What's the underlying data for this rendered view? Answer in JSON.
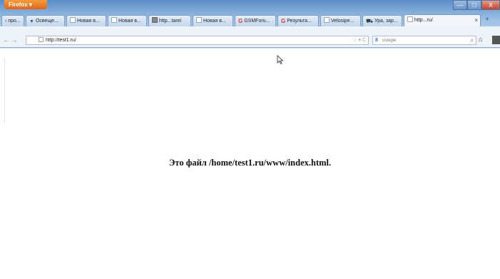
{
  "browser": {
    "app_button": "Firefox",
    "window_controls": [
      "—",
      "□",
      "X"
    ]
  },
  "tabs": [
    {
      "label": "‹ про...",
      "icon": "none"
    },
    {
      "label": "Освеще...",
      "icon": "chevron-down-icon"
    },
    {
      "label": "Новая в...",
      "icon": "blank-page-icon"
    },
    {
      "label": "Новая в...",
      "icon": "blank-page-icon"
    },
    {
      "label": "http...tarei",
      "icon": "image-icon"
    },
    {
      "label": "Новая в...",
      "icon": "blank-page-icon"
    },
    {
      "label": "GSMForu...",
      "icon": "g-logo-icon"
    },
    {
      "label": "Результа...",
      "icon": "g-logo-icon"
    },
    {
      "label": "Velosipe...",
      "icon": "blank-page-icon"
    },
    {
      "label": "Ура, зар...",
      "icon": "car-icon"
    },
    {
      "label": "http...ru/",
      "icon": "blank-page-icon",
      "active": true
    }
  ],
  "tab_close_glyph": "×",
  "new_tab_glyph": "+",
  "navbar": {
    "back_forward": "← →",
    "url": "http://test1.ru/",
    "url_end_glyphs": "☆ ▾ C",
    "search_placeholder": "Google",
    "search_engine_logo": "8",
    "search_icon_glyph": "⌕",
    "home_glyph": "⌂"
  },
  "page": {
    "message": "Это файл /home/test1.ru/www/index.html."
  }
}
